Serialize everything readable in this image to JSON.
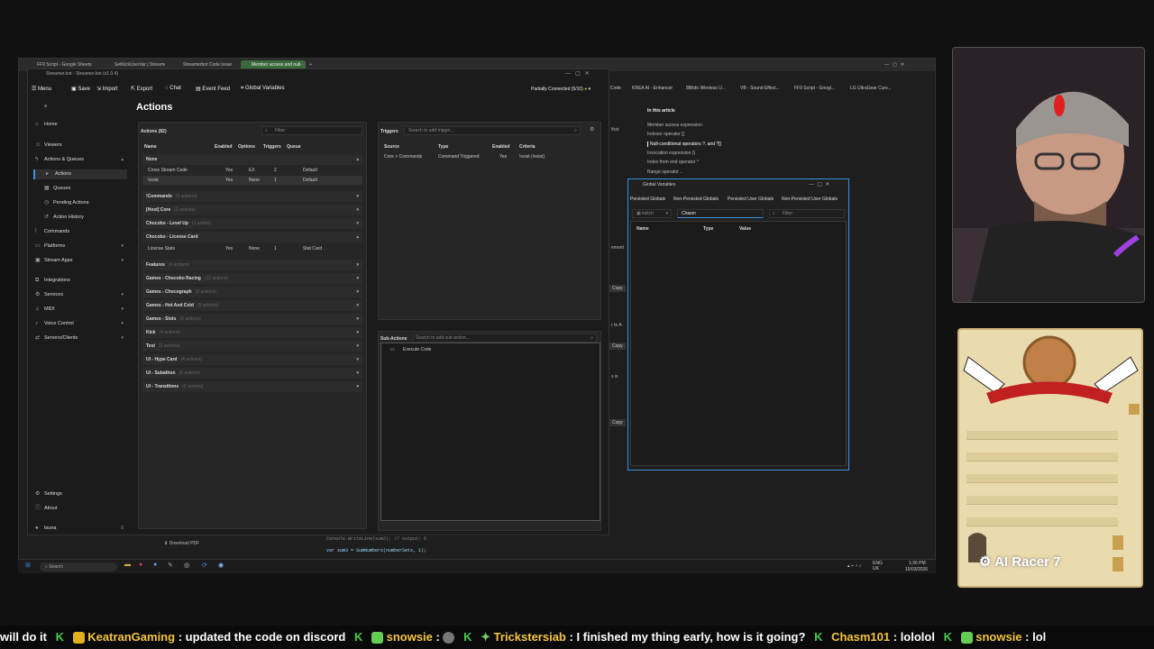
{
  "browser": {
    "tabs": [
      {
        "label": "FF9 Script - Google Sheets"
      },
      {
        "label": "SetKickUserVar | Streamer.bot"
      },
      {
        "label": "Streamerbot Code Issue"
      },
      {
        "label": "Member access and null-"
      }
    ],
    "bookmarks": [
      "Code",
      "KREA AI - Enhancer",
      "8Bitdo Wireless U...",
      "VB - Sound Effect...",
      "FF9 Script - Googl...",
      "LG UltraGear Curv..."
    ]
  },
  "streamerbot": {
    "title": "Streamer.bot - Streamer.bot (v1.0.4)",
    "toolbar": {
      "menu": "Menu",
      "save": "Save",
      "import": "Import",
      "export": "Export",
      "chat": "Chat",
      "event_feed": "Event Feed",
      "global_variables": "Global Variables",
      "status": "Partially Connected (5/10)"
    },
    "sidebar": {
      "home": "Home",
      "viewers": "Viewers",
      "actions_queues": "Actions & Queues",
      "actions": "Actions",
      "queues": "Queues",
      "pending_actions": "Pending Actions",
      "action_history": "Action History",
      "commands": "Commands",
      "platforms": "Platforms",
      "stream_apps": "Stream Apps",
      "integrations": "Integrations",
      "services": "Services",
      "midi": "MIDI",
      "voice_control": "Voice Control",
      "servers_clients": "Servers/Clients",
      "settings": "Settings",
      "about": "About",
      "user": "tsuna",
      "user_count": "0"
    },
    "actions": {
      "title": "Actions",
      "panel_label": "Actions (82)",
      "filter_placeholder": "Filter",
      "columns": [
        "Name",
        "Enabled",
        "Options",
        "Triggers",
        "Queue"
      ],
      "none_group": "None",
      "none_rows": [
        {
          "name": "Cross Stream Code",
          "enabled": "Yes",
          "options": "EX",
          "triggers": "2",
          "queue": "Default"
        },
        {
          "name": "!exist",
          "enabled": "Yes",
          "options": "None",
          "triggers": "1",
          "queue": "Default"
        }
      ],
      "groups": [
        {
          "name": "!Commands",
          "count": "(3 actions)"
        },
        {
          "name": "[Host] Core",
          "count": "(2 actions)"
        },
        {
          "name": "Chocobo - Level Up",
          "count": "(1 action)"
        }
      ],
      "license_group": "Chocobo - License Card",
      "license_row": {
        "name": "License Stats",
        "enabled": "Yes",
        "options": "None",
        "triggers": "1",
        "queue": "Stat Card"
      },
      "groups2": [
        {
          "name": "Features",
          "count": "(4 actions)"
        },
        {
          "name": "Games - Chocobo Racing",
          "count": "(12 actions)"
        },
        {
          "name": "Games - Chocograph",
          "count": "(3 actions)"
        },
        {
          "name": "Games - Hot And Cold",
          "count": "(5 actions)"
        },
        {
          "name": "Games - Slots",
          "count": "(3 actions)"
        },
        {
          "name": "Kick",
          "count": "(4 actions)"
        },
        {
          "name": "Test",
          "count": "(2 actions)"
        },
        {
          "name": "UI - Hype Card",
          "count": "(4 actions)"
        },
        {
          "name": "UI - Subathon",
          "count": "(6 actions)"
        },
        {
          "name": "UI - Transitions",
          "count": "(2 actions)"
        }
      ]
    },
    "triggers": {
      "label": "Triggers",
      "search_placeholder": "Search to add trigger...",
      "columns": [
        "Source",
        "Type",
        "Enabled",
        "Criteria"
      ],
      "rows": [
        {
          "source": "Core > Commands",
          "type": "Command Triggered",
          "enabled": "Yes",
          "criteria": "!exist (!exist)"
        }
      ]
    },
    "subactions": {
      "label": "Sub-Actions",
      "search_placeholder": "Search to add sub-action...",
      "items": [
        "Execute Code"
      ]
    }
  },
  "article": {
    "heading": "In this article",
    "items": [
      "Member access expression .",
      "Indexer operator []",
      "Null-conditional operators ?. and ?[]",
      "Invocation expression ()",
      "Index from end operator ^",
      "Range operator .."
    ],
    "side_texts": [
      "that",
      "ement",
      "r to A",
      "s is"
    ],
    "copy": "Copy",
    "code1": "Console.WriteLine(sum2);  // output: 6",
    "code2": "var sum3 = SumNumbers(numberSets, 1);"
  },
  "global_variables": {
    "title": "Global Variables",
    "tabs": [
      "Persisted Globals",
      "Non-Persisted Globals",
      "Persisted User Globals",
      "Non-Persisted User Globals"
    ],
    "platform": "twitch",
    "user_input": "Chasm",
    "filter_placeholder": "Filter",
    "columns": [
      "Name",
      "Type",
      "Value"
    ]
  },
  "pdf": {
    "label": "Download PDF"
  },
  "taskbar": {
    "search": "Search",
    "lang": "ENG\nUK",
    "time": "1:36 PM",
    "date": "15/03/2026"
  },
  "card": {
    "label": "AI Racer 7"
  },
  "ticker": [
    {
      "name": "",
      "text": "will do it"
    },
    {
      "name": "KeatranGaming",
      "text": ": updated the code on discord"
    },
    {
      "name": "snowsie",
      "text": ":"
    },
    {
      "name": "Trickstersiab",
      "text": ": I finished my thing early, how is it going?"
    },
    {
      "name": "Chasm101",
      "text": ": lololol"
    },
    {
      "name": "snowsie",
      "text": ": lol"
    }
  ],
  "colors": {
    "accent": "#3d8fe0",
    "tab_active": "#3a6a3a",
    "ticker_name": "#f4c542",
    "kick_green": "#48c94a"
  }
}
